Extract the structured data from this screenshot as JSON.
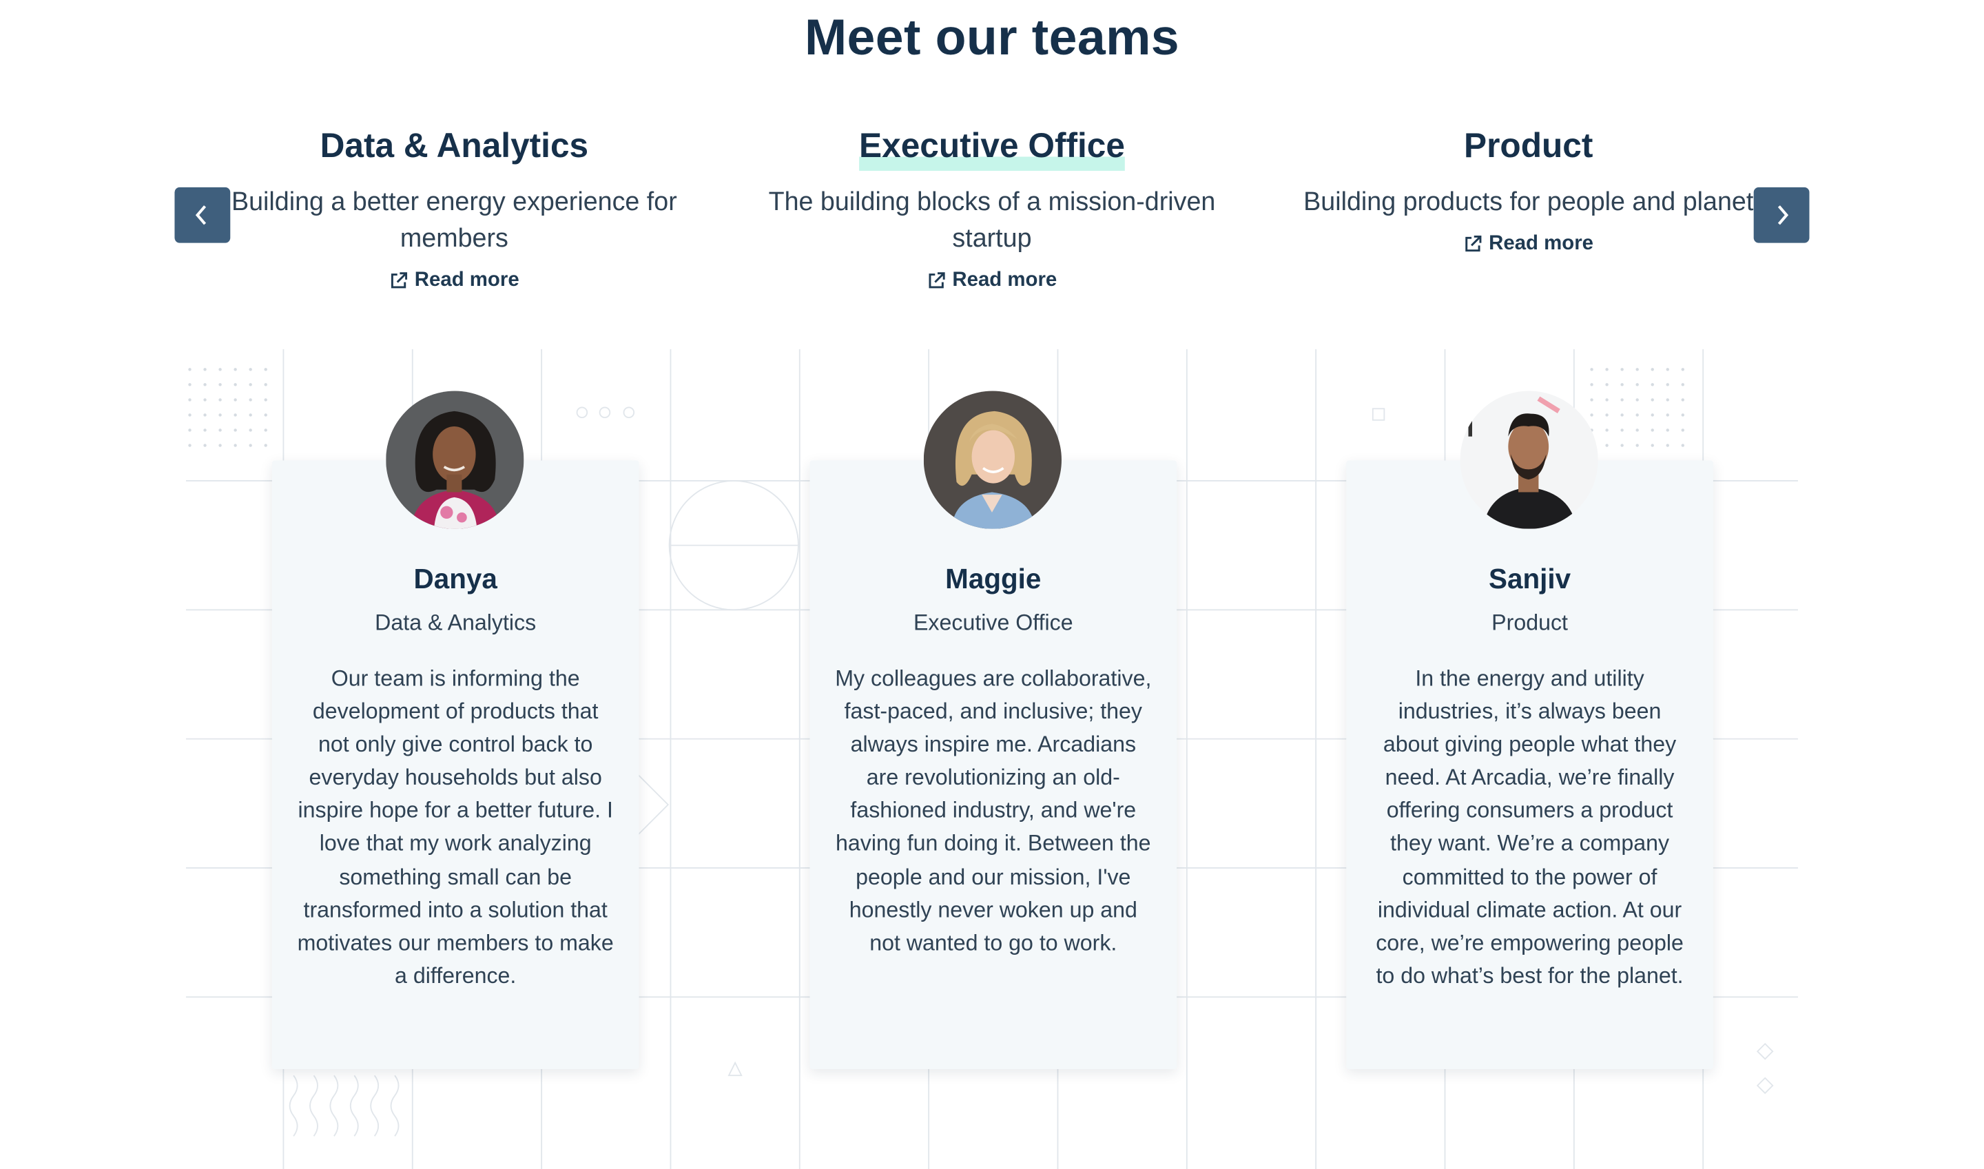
{
  "page_title": "Meet our teams",
  "nav": {
    "prev_icon": "chevron-left-icon",
    "next_icon": "chevron-right-icon"
  },
  "teams": [
    {
      "name": "Data & Analytics",
      "description": "Building a better energy experience for members",
      "read_more": "Read more"
    },
    {
      "name": "Executive Office",
      "description": "The building blocks of a mission-driven startup",
      "read_more": "Read more"
    },
    {
      "name": "Product",
      "description": "Building products for people and planet",
      "read_more": "Read more"
    }
  ],
  "people": [
    {
      "name": "Danya",
      "team": "Data & Analytics",
      "quote": "Our team is informing the development of products that not only give control back to everyday households but also inspire hope for a better future. I love that my work analyzing something small can be transformed into a solution that motivates our members to make a difference."
    },
    {
      "name": "Maggie",
      "team": "Executive Office",
      "quote": "My colleagues are collaborative, fast-paced, and inclusive; they always inspire me. Arcadians are revolutionizing an old-fashioned industry, and we're having fun doing it. Between the people and our mission, I've honestly never woken up and not wanted to go to work."
    },
    {
      "name": "Sanjiv",
      "team": "Product",
      "quote": "In the energy and utility industries, it’s always been about giving people what they need. At Arcadia, we’re finally offering consumers a product they want. We’re a company committed to the power of individual climate action. At our core, we’re empowering people to do what’s best for the planet."
    }
  ],
  "colors": {
    "heading": "#16304a",
    "body": "#2f4254",
    "nav_button": "#3f5f7d",
    "card_bg": "#f4f8fa",
    "highlight": "#c6f5ea",
    "grid": "#dfe5ea"
  }
}
